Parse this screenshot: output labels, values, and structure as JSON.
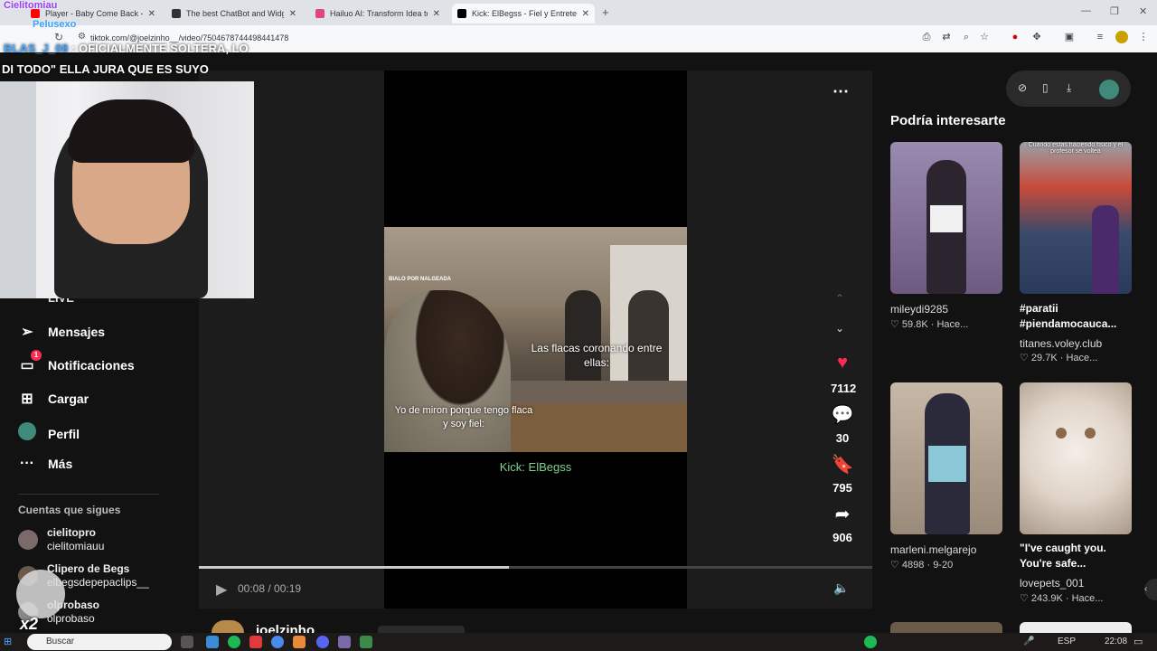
{
  "tabs": [
    {
      "title": "Player - Baby Come Back - YouT",
      "favicon_color": "#ff0000"
    },
    {
      "title": "The best ChatBot and Widgets",
      "favicon_color": "#333333"
    },
    {
      "title": "Hailuo AI: Transform Idea to Vi",
      "favicon_color": "#e0457b"
    },
    {
      "title": "Kick: ElBegss - Fiel y Entretenid",
      "favicon_color": "#000000"
    }
  ],
  "new_tab": "+",
  "address": "tiktok.com/@joelzinho__/video/7504678744498441478",
  "stream_overlay": {
    "chat_user1": "Cielitomiau",
    "chat_user2": "Pelusexo",
    "headline_user": "BLAS_J_08",
    "headline_line1": "OFICIALMENTE SOLTERA, LO",
    "headline_line2": "DI TODO\" ELLA JURA QUE ES SUYO",
    "multiplier": "x2"
  },
  "leftnav": {
    "partial_item": "LIVE",
    "items": [
      {
        "label": "Mensajes",
        "icon": "send-icon"
      },
      {
        "label": "Notificaciones",
        "icon": "inbox-icon",
        "badge": "1"
      },
      {
        "label": "Cargar",
        "icon": "upload-icon"
      },
      {
        "label": "Perfil",
        "icon": "profile-icon"
      },
      {
        "label": "Más",
        "icon": "more-icon"
      }
    ],
    "following_title": "Cuentas que sigues",
    "accounts": [
      {
        "name": "cielitopro",
        "handle": "cielitomiauu"
      },
      {
        "name": "Clipero de Begs",
        "handle": "elbegsdepepaclips__"
      },
      {
        "name": "olprobaso",
        "handle": "olprobaso"
      }
    ]
  },
  "video": {
    "watermark": "BIALO POR NALGEADA",
    "caption_top": "Las flacas coronando entre ellas:",
    "caption_bottom": "Yo de miron porque tengo flaca y soy fiel:",
    "credit": "Kick: ElBegss",
    "time_current": "00:08",
    "time_total": "00:19",
    "progress": 0.46,
    "author": "joelzinho"
  },
  "actions": {
    "likes": "7112",
    "comments": "30",
    "saves": "795",
    "shares": "906"
  },
  "recommend": {
    "title": "Podría interesarte",
    "cards": [
      {
        "user": "mileydi9285",
        "likes": "59.8K",
        "time": "Hace...",
        "title": "",
        "color": "#7a6a8a"
      },
      {
        "user": "titanes.voley.club",
        "likes": "29.7K",
        "time": "Hace...",
        "title": "#paratii #piendamocauca...",
        "overlay": "Cuando estas haciendo físico y el profesor se voltea",
        "color": "#3a4a5a"
      },
      {
        "user": "marleni.melgarejo",
        "likes": "4898",
        "time": "9-20",
        "title": "",
        "color": "#8a7a6a"
      },
      {
        "user": "lovepets_001",
        "likes": "243.9K",
        "time": "Hace...",
        "title": "\"I've caught you. You're safe...",
        "color": "#c8b8a8"
      }
    ]
  },
  "taskbar": {
    "search_label": "Buscar",
    "lang": "ESP",
    "clock": "22:08"
  }
}
